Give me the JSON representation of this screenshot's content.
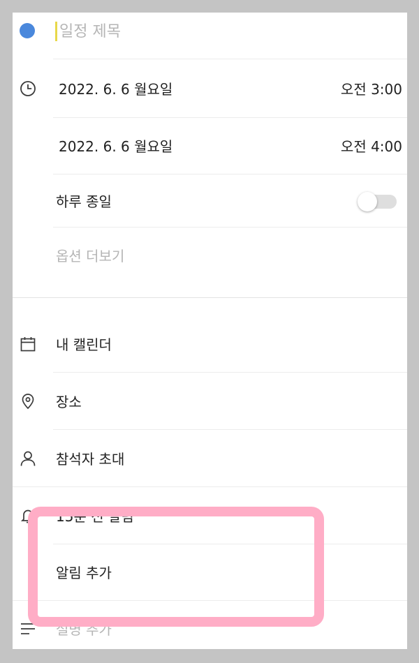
{
  "title": {
    "placeholder": "일정 제목",
    "color_dot": "#4a88dc",
    "cursor_color": "#e8d84a"
  },
  "start": {
    "date": "2022. 6. 6 월요일",
    "time": "오전 3:00"
  },
  "end": {
    "date": "2022. 6. 6 월요일",
    "time": "오전 4:00"
  },
  "all_day": {
    "label": "하루 종일",
    "enabled": false
  },
  "more_options": "옵션 더보기",
  "calendar": {
    "label": "내 캘린더"
  },
  "location": {
    "label": "장소"
  },
  "guests": {
    "label": "참석자 초대"
  },
  "reminder": {
    "label": "15분 전 알림",
    "add_label": "알림 추가"
  },
  "description": {
    "label": "설명 추가"
  },
  "icons": {
    "clock": "clock-icon",
    "calendar": "calendar-icon",
    "location": "map-pin-icon",
    "guests": "person-icon",
    "reminder": "bell-icon",
    "description": "description-lines-icon"
  },
  "colors": {
    "highlight": "#ffadc6",
    "background": "#c4c4c4"
  }
}
